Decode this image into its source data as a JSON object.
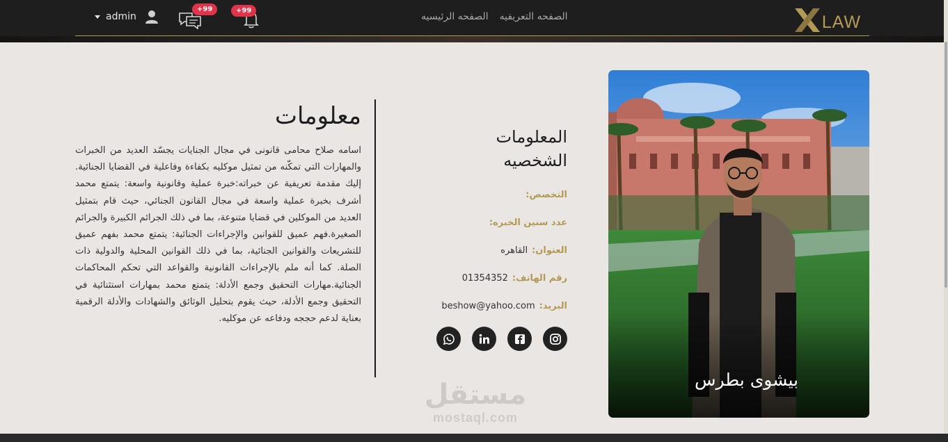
{
  "navbar": {
    "logo_text": "LAW",
    "links": [
      "الصفحه التعريفيه",
      "الصفحه الرئيسيه"
    ],
    "user_name": "admin",
    "messages_badge": "+99",
    "notifications_badge": "+99"
  },
  "profile": {
    "name": "بيشوى بطرس"
  },
  "personal_info": {
    "title": "المعلومات الشخصيه",
    "specialty_label": "التخصص:",
    "specialty_value": "",
    "experience_label": "عدد سنين الخبره:",
    "experience_value": "",
    "address_label": "العنوان:",
    "address_value": "القاهره",
    "phone_label": "رقم الهاتف:",
    "phone_value": "01354352",
    "email_label": "البريد:",
    "email_value": "beshow@yahoo.com",
    "socials": [
      "instagram-icon",
      "facebook-icon",
      "linkedin-icon",
      "whatsapp-icon"
    ]
  },
  "about": {
    "title": "معلومات",
    "text": "اسامه صلاح محامى قانونى في مجال الجنايات يجسّد العديد من الخبرات والمهارات التي تمكّنه من تمثيل موكليه بكفاءة وفاعلية في القضايا الجنائية. إليك مقدمة تعريفية عن خبراته:خبرة عملية وقانونية واسعة: يتمتع محمد أشرف بخبرة عملية واسعة في مجال القانون الجنائي، حيث قام بتمثيل العديد من الموكلين في قضايا متنوعة، بما في ذلك الجرائم الكبيرة والجرائم الصغيرة.فهم عميق للقوانين والإجراءات الجنائية: يتمتع محمد بفهم عميق للتشريعات والقوانين الجنائية، بما في ذلك القوانين المحلية والدولية ذات الصلة. كما أنه ملم بالإجراءات القانونية والقواعد التي تحكم المحاكمات الجنائية.مهارات التحقيق وجمع الأدلة: يتمتع محمد بمهارات استثنائية في التحقيق وجمع الأدلة، حيث يقوم بتحليل الوثائق والشهادات والأدلة الرقمية بعناية لدعم حججه ودفاعه عن موكليه."
  },
  "watermark": {
    "arabic": "مستقل",
    "latin": "mostaql.com"
  },
  "colors": {
    "accent": "#b39a55",
    "navbar": "#1e1e1e",
    "background": "#e9e6e3",
    "badge": "#e0344a"
  }
}
